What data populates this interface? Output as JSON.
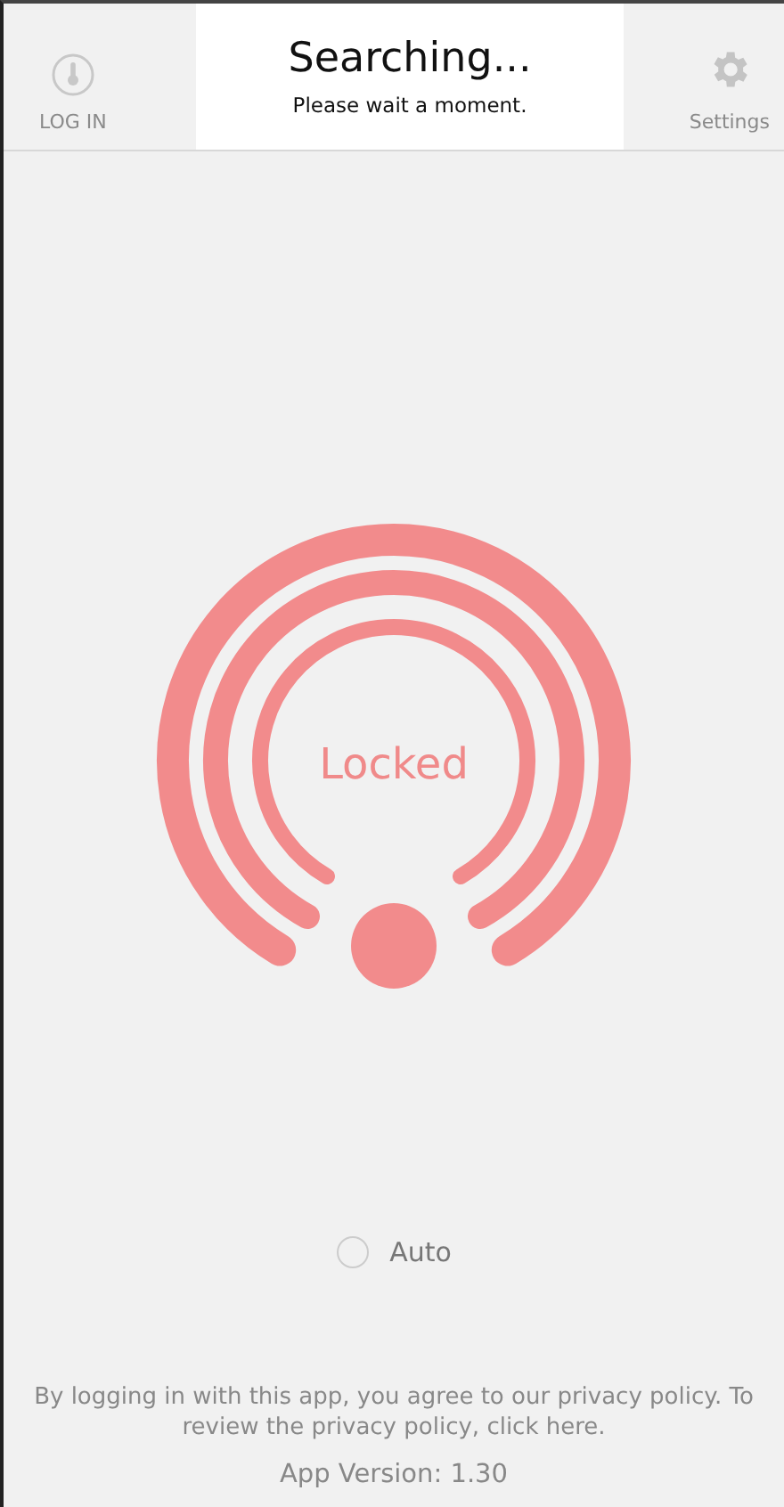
{
  "header": {
    "login_label": "LOG IN",
    "settings_label": "Settings"
  },
  "toast": {
    "title": "Searching...",
    "message": "Please wait a moment."
  },
  "lock": {
    "status": "Locked"
  },
  "auto": {
    "label": "Auto",
    "checked": false
  },
  "footer": {
    "privacy_text": "By logging in with this app, you agree to our privacy policy. To review the privacy policy,",
    "privacy_link": "click here.",
    "version": "App Version: 1.30"
  }
}
